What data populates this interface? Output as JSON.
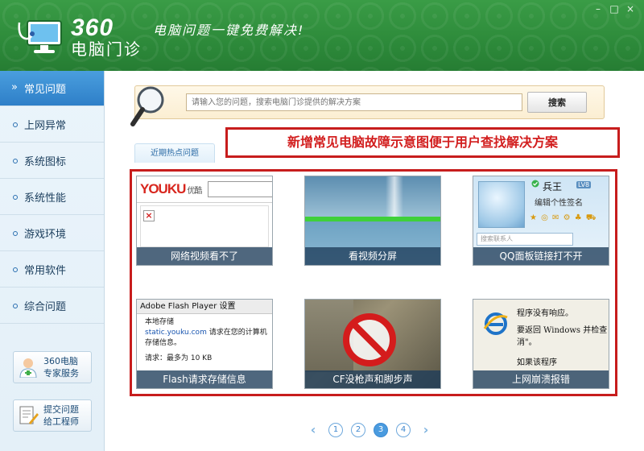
{
  "header": {
    "brand_number": "360",
    "brand_name": "电脑门诊",
    "slogan": "电脑问题一键免费解决!",
    "window_controls": {
      "minimize": "–",
      "maximize": "□",
      "close": "×"
    }
  },
  "sidebar": {
    "items": [
      {
        "label": "常见问题",
        "active": true
      },
      {
        "label": "上网异常"
      },
      {
        "label": "系统图标"
      },
      {
        "label": "系统性能"
      },
      {
        "label": "游戏环境"
      },
      {
        "label": "常用软件"
      },
      {
        "label": "综合问题"
      }
    ],
    "service_button": {
      "line1": "360电脑",
      "line2": "专家服务"
    },
    "submit_button": {
      "line1": "提交问题",
      "line2": "给工程师"
    }
  },
  "search": {
    "placeholder": "请输入您的问题，搜索电脑门诊提供的解决方案",
    "button_label": "搜索"
  },
  "hot_tab": "近期热点问题",
  "banner": "新增常见电脑故障示意图便于用户查找解决方案",
  "tiles": [
    {
      "caption": "网络视频看不了",
      "logo": "YOUKU",
      "logo_sub": "优酷"
    },
    {
      "caption": "看视频分屏"
    },
    {
      "caption": "QQ面板链接打不开",
      "qq_name": "兵王",
      "qq_level": "LV8",
      "qq_sign": "编辑个性签名",
      "qq_search": "搜索联系人"
    },
    {
      "caption": "Flash请求存储信息",
      "dialog_title": "Adobe Flash Player 设置",
      "line1": "本地存储",
      "line2_url": "static.youku.com",
      "line2_rest": " 请求在您的计算机",
      "line3": "存储信息。",
      "line4": "请求：最多为 10 KB"
    },
    {
      "caption": "CF没枪声和脚步声"
    },
    {
      "caption": "上网崩溃报错",
      "line1": "程序没有响应。",
      "line2": "要返回 Windows 并检查",
      "line3": "消\"。",
      "line4": "如果该程序"
    }
  ],
  "pager": {
    "prev": "‹",
    "next": "›",
    "pages": [
      "1",
      "2",
      "3",
      "4"
    ],
    "current": "3"
  },
  "colors": {
    "header_green": "#2d8a3a",
    "active_blue": "#2e7fc8",
    "alert_red": "#c71d1d"
  }
}
